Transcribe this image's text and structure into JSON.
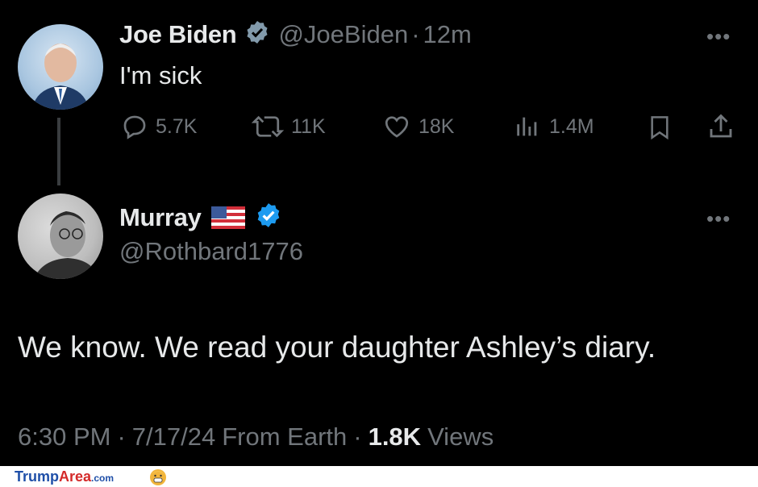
{
  "tweet1": {
    "name": "Joe Biden",
    "handle": "@JoeBiden",
    "separator": "·",
    "time": "12m",
    "text": "I'm sick",
    "more": "•••",
    "stats": {
      "replies": "5.7K",
      "retweets": "11K",
      "likes": "18K",
      "views": "1.4M"
    }
  },
  "tweet2": {
    "name": "Murray",
    "flag": "🇺🇸",
    "handle": "@Rothbard1776",
    "more": "•••",
    "text": "We know. We read your daughter Ashley’s diary.",
    "meta": {
      "time": "6:30 PM",
      "sep1": "·",
      "date": "7/17/24",
      "source": "From Earth",
      "sep2": "·",
      "views_count": "1.8K",
      "views_label": "Views"
    }
  },
  "watermark": {
    "part1": "Trump",
    "part2": "Area",
    "part3": ".com"
  },
  "colors": {
    "background": "#000000",
    "text": "#e7e9ea",
    "muted": "#71767b",
    "verified_blue": "#1d9bf0",
    "verified_gray": "#829aab"
  }
}
